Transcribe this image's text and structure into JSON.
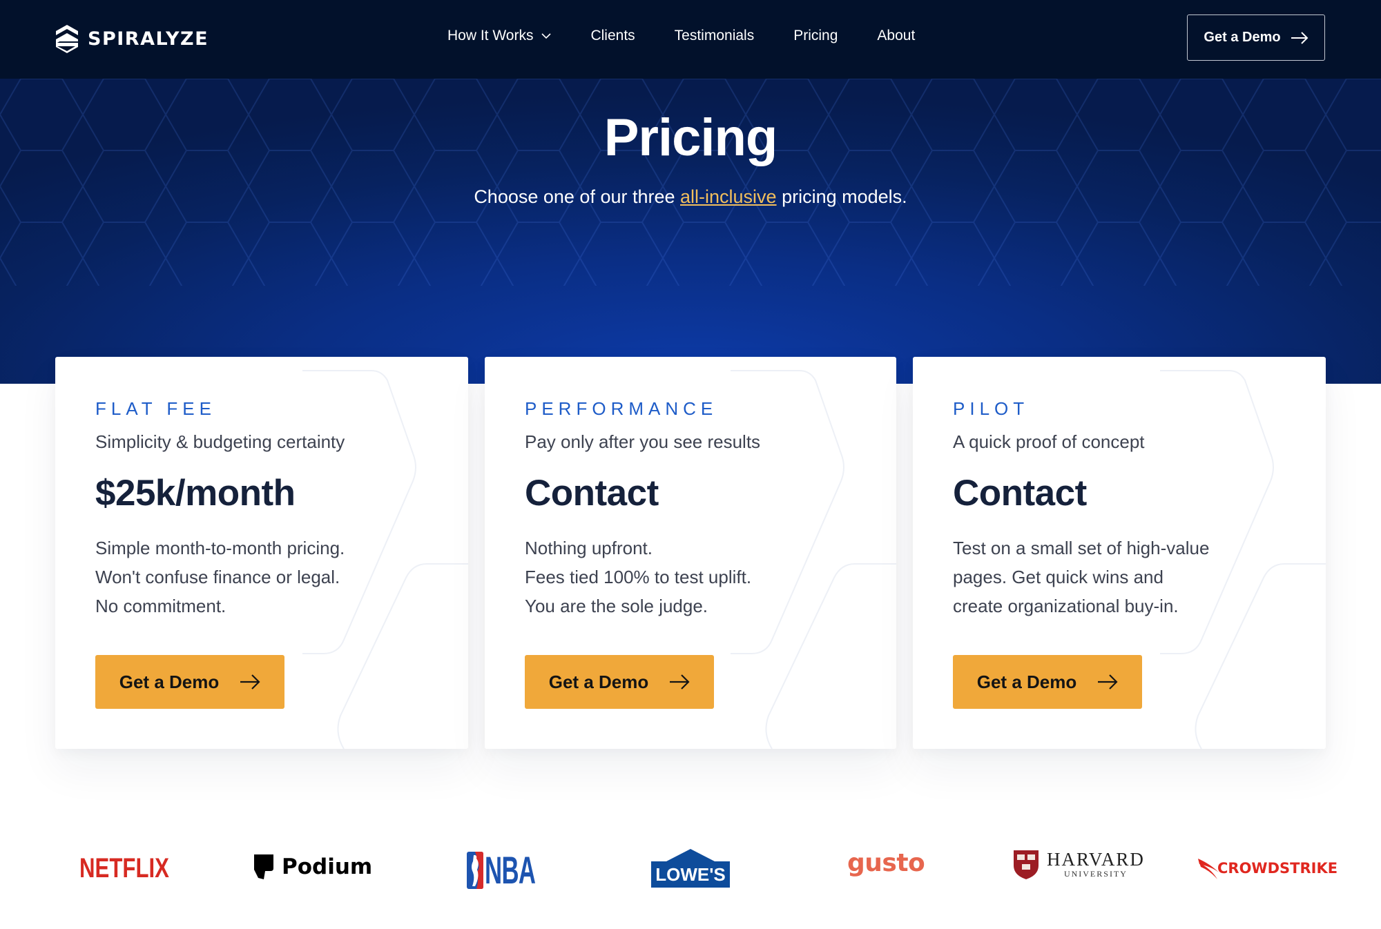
{
  "nav": {
    "brand": "SPIRALYZE",
    "links": [
      {
        "label": "How It Works",
        "has_dropdown": true
      },
      {
        "label": "Clients"
      },
      {
        "label": "Testimonials"
      },
      {
        "label": "Pricing"
      },
      {
        "label": "About"
      }
    ],
    "cta_label": "Get a Demo"
  },
  "hero": {
    "title": "Pricing",
    "subtitle_before": "Choose one of our three ",
    "subtitle_link": "all-inclusive",
    "subtitle_after": " pricing models."
  },
  "cards": [
    {
      "label": "FLAT FEE",
      "tagline": "Simplicity & budgeting certainty",
      "price": "$25k/month",
      "description": [
        "Simple month-to-month pricing.",
        "Won't confuse finance or legal.",
        "No commitment."
      ],
      "button_label": "Get a Demo"
    },
    {
      "label": "PERFORMANCE",
      "tagline": "Pay only after you see results",
      "price": "Contact",
      "description": [
        "Nothing upfront.",
        "Fees tied 100% to test uplift.",
        "You are the sole judge."
      ],
      "button_label": "Get a Demo"
    },
    {
      "label": "PILOT",
      "tagline": "A quick proof of concept",
      "price": "Contact",
      "description": [
        "Test on a small set of high-value",
        "pages. Get quick wins and",
        "create organizational buy-in."
      ],
      "button_label": "Get a Demo"
    }
  ],
  "client_logos": {
    "netflix": "NETFLIX",
    "podium": "Podium",
    "nba": "NBA",
    "lowes": "LOWE'S",
    "gusto": "gusto",
    "harvard_name": "HARVARD",
    "harvard_sub": "UNIVERSITY",
    "crowdstrike": "CROWDSTRIKE"
  },
  "colors": {
    "nav_bg": "#02112b",
    "hero_blue": "#0a2e85",
    "accent_label": "#1e5cc8",
    "cta_orange": "#f0a83a",
    "link_gold": "#f2bf5c"
  }
}
